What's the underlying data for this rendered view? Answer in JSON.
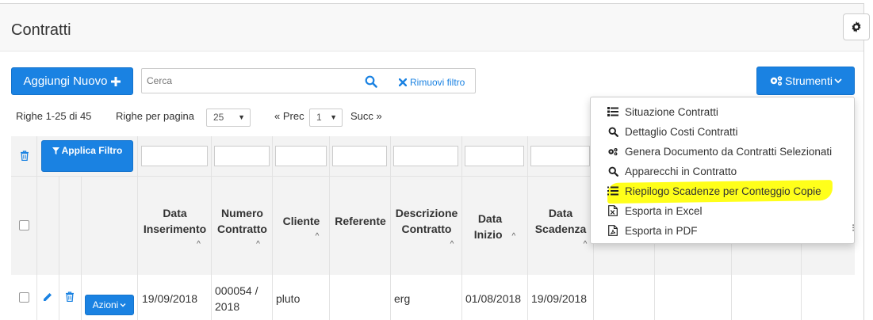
{
  "page": {
    "title": "Contratti"
  },
  "toolbar": {
    "add_label": "Aggiungi Nuovo",
    "search_placeholder": "Cerca",
    "clear_filter_label": "Rimuovi filtro",
    "tools_label": "Strumenti"
  },
  "pager": {
    "rows_info": "Righe 1-25 di 45",
    "per_page_label": "Righe per pagina",
    "per_page_value": "25",
    "prev_label": "« Prec",
    "page_value": "1",
    "next_label": "Succ »"
  },
  "table": {
    "apply_filter_label": "Applica Filtro",
    "columns": [
      {
        "label_1": "Data",
        "label_2": "Inserimento"
      },
      {
        "label_1": "Numero",
        "label_2": "Contratto"
      },
      {
        "label_1": "Cliente",
        "label_2": ""
      },
      {
        "label_1": "Referente",
        "label_2": ""
      },
      {
        "label_1": "Descrizione",
        "label_2": "Contratto"
      },
      {
        "label_1": "Data",
        "label_2": "Inizio"
      },
      {
        "label_1": "Data",
        "label_2": "Scadenza"
      }
    ],
    "sort_caret": "^",
    "actions_label": "Azioni",
    "rows": [
      {
        "data_inserimento": "19/09/2018",
        "numero_line1": "000054 /",
        "numero_line2": "2018",
        "cliente": "pluto",
        "referente": "",
        "descrizione": "erg",
        "data_inizio": "01/08/2018",
        "data_scadenza": "19/09/2018"
      }
    ]
  },
  "tools_menu": {
    "items": [
      {
        "label": "Situazione Contratti",
        "icon": "list-icon"
      },
      {
        "label": "Dettaglio Costi Contratti",
        "icon": "search-icon"
      },
      {
        "label": "Genera Documento da Contratti Selezionati",
        "icon": "gears-icon"
      },
      {
        "label": "Apparecchi in Contratto",
        "icon": "search-icon"
      },
      {
        "label": "Riepilogo Scadenze per Conteggio Copie",
        "icon": "list-ol-icon"
      },
      {
        "label": "Esporta in Excel",
        "icon": "file-excel-icon"
      },
      {
        "label": "Esporta in PDF",
        "icon": "file-pdf-icon"
      }
    ]
  },
  "colors": {
    "primary": "#1a82e2",
    "highlight": "#ffff1a"
  }
}
